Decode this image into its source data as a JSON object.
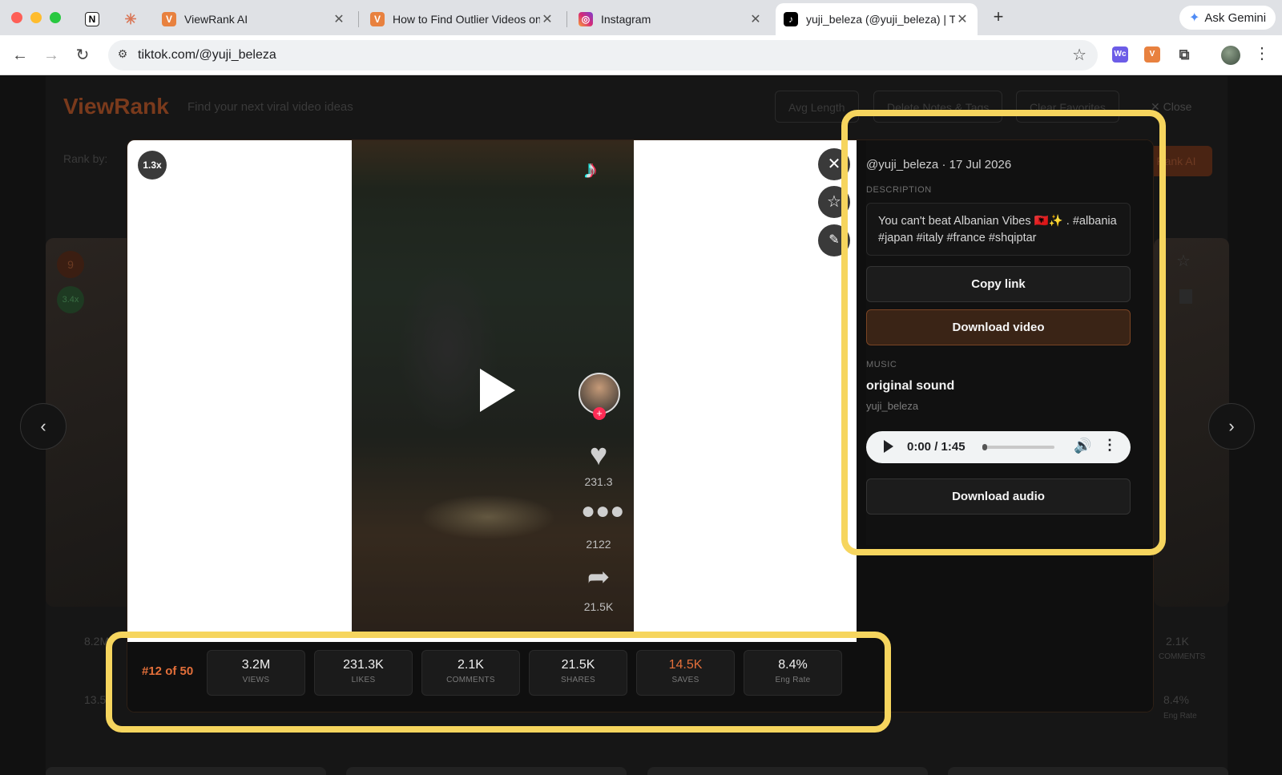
{
  "browser": {
    "tabs": [
      {
        "title": "",
        "icon": "notion-icon"
      },
      {
        "title": "",
        "icon": "claude-icon"
      },
      {
        "title": "ViewRank AI",
        "icon": "viewrank-icon"
      },
      {
        "title": "How to Find Outlier Videos on",
        "icon": "viewrank-icon"
      },
      {
        "title": "Instagram",
        "icon": "instagram-icon"
      },
      {
        "title": "yuji_beleza (@yuji_beleza) | T",
        "icon": "tiktok-icon",
        "active": true
      }
    ],
    "gemini_label": "Ask Gemini",
    "url": "tiktok.com/@yuji_beleza"
  },
  "page": {
    "logo": "ViewRank",
    "tagline": "Find your next viral video ideas",
    "header_buttons": [
      "Avg Length",
      "Delete Notes & Tags",
      "Clear Favorites"
    ],
    "close_label": "✕ Close",
    "rank_by_label": "Rank by:",
    "rank_ai_label": "Rank AI",
    "bg_card_badges": [
      "9",
      "3.4x"
    ],
    "bg_stats_left": [
      "8.2M",
      "13.5"
    ],
    "bg_stats_right": [
      "2.1K",
      "8.4%"
    ],
    "bg_stat_labels_right": [
      "COMMENTS",
      "Eng Rate"
    ]
  },
  "modal": {
    "speed_badge": "1.3x",
    "video_counts": {
      "likes": "231.3",
      "comments": "2122",
      "shares": "21.5K"
    },
    "rank_position": "#12 of 50",
    "stats": [
      {
        "value": "3.2M",
        "label": "VIEWS"
      },
      {
        "value": "231.3K",
        "label": "LIKES"
      },
      {
        "value": "2.1K",
        "label": "COMMENTS"
      },
      {
        "value": "21.5K",
        "label": "SHARES"
      },
      {
        "value": "14.5K",
        "label": "SAVES",
        "highlight_color": "#e36f3a"
      },
      {
        "value": "8.4%",
        "label": "Eng Rate"
      }
    ],
    "panel": {
      "author_date": "@yuji_beleza · 17 Jul 2026",
      "description_label": "DESCRIPTION",
      "description": "You can't beat Albanian Vibes 🇦🇱✨ . #albania #japan #italy #france #shqiptar",
      "copy_link": "Copy link",
      "download_video": "Download video",
      "music_label": "MUSIC",
      "music_title": "original sound",
      "music_artist": "yuji_beleza",
      "audio_time": "0:00 / 1:45",
      "audio_progress": 0,
      "download_audio": "Download audio"
    }
  },
  "colors": {
    "accent": "#e36f3a",
    "highlight_frame": "#f6d55e"
  }
}
